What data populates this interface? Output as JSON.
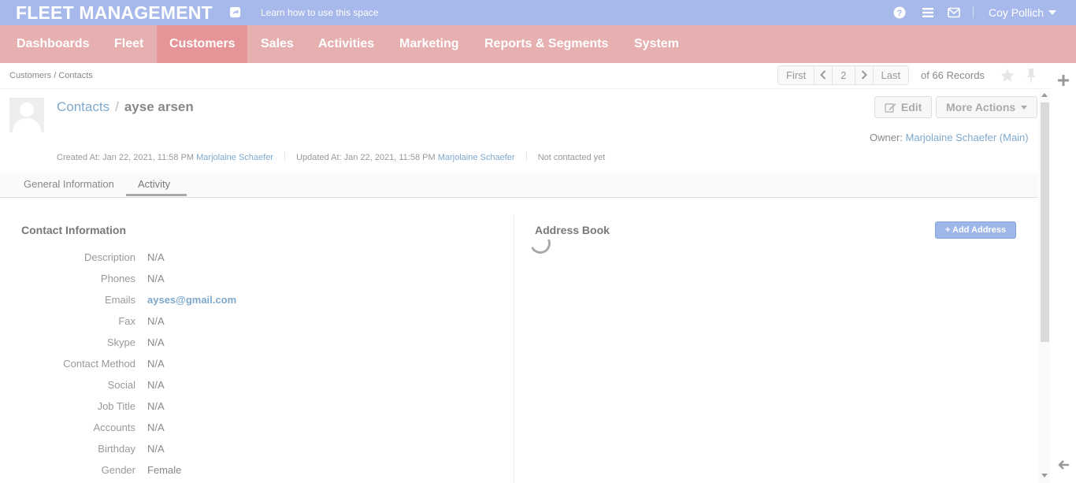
{
  "topbar": {
    "brand": "FLEET MANAGEMENT",
    "learn_link": "Learn how to use this space",
    "user_name": "Coy Pollich",
    "icons": [
      "share-icon",
      "help-icon",
      "menu-icon",
      "mail-icon",
      "caret-down-icon"
    ]
  },
  "nav": {
    "items": [
      {
        "label": "Dashboards"
      },
      {
        "label": "Fleet"
      },
      {
        "label": "Customers",
        "active": true
      },
      {
        "label": "Sales"
      },
      {
        "label": "Activities"
      },
      {
        "label": "Marketing"
      },
      {
        "label": "Reports & Segments"
      },
      {
        "label": "System"
      }
    ]
  },
  "breadcrumb": "Customers / Contacts",
  "pager": {
    "first": "First",
    "page": "2",
    "last": "Last",
    "records": "of 66 Records"
  },
  "header": {
    "section_link": "Contacts",
    "separator": "/",
    "name": "ayse arsen",
    "edit_label": "Edit",
    "more_actions_label": "More Actions",
    "owner_label": "Owner:",
    "owner_name": "Marjolaine Schaefer",
    "owner_unit": "(Main)"
  },
  "meta": {
    "created_label": "Created At: Jan 22, 2021, 11:58 PM",
    "created_by": "Marjolaine Schaefer",
    "updated_label": "Updated At: Jan 22, 2021, 11:58 PM",
    "updated_by": "Marjolaine Schaefer",
    "contacted": "Not contacted yet"
  },
  "tabs": [
    {
      "label": "General Information"
    },
    {
      "label": "Activity",
      "active": true
    }
  ],
  "contact_info": {
    "title": "Contact Information",
    "fields": [
      {
        "label": "Description",
        "value": "N/A"
      },
      {
        "label": "Phones",
        "value": "N/A"
      },
      {
        "label": "Emails",
        "value": "ayses@gmail.com"
      },
      {
        "label": "Fax",
        "value": "N/A"
      },
      {
        "label": "Skype",
        "value": "N/A"
      },
      {
        "label": "Contact Method",
        "value": "N/A"
      },
      {
        "label": "Social",
        "value": "N/A"
      },
      {
        "label": "Job Title",
        "value": "N/A"
      },
      {
        "label": "Accounts",
        "value": "N/A"
      },
      {
        "label": "Birthday",
        "value": "N/A"
      },
      {
        "label": "Gender",
        "value": "Female"
      }
    ]
  },
  "address_book": {
    "title": "Address Book",
    "add_label": "+ Add Address"
  },
  "colors": {
    "topbar": "#a7b8ea",
    "nav": "#e6afb0",
    "nav_active": "#e59597",
    "link": "#7fa9cc"
  }
}
